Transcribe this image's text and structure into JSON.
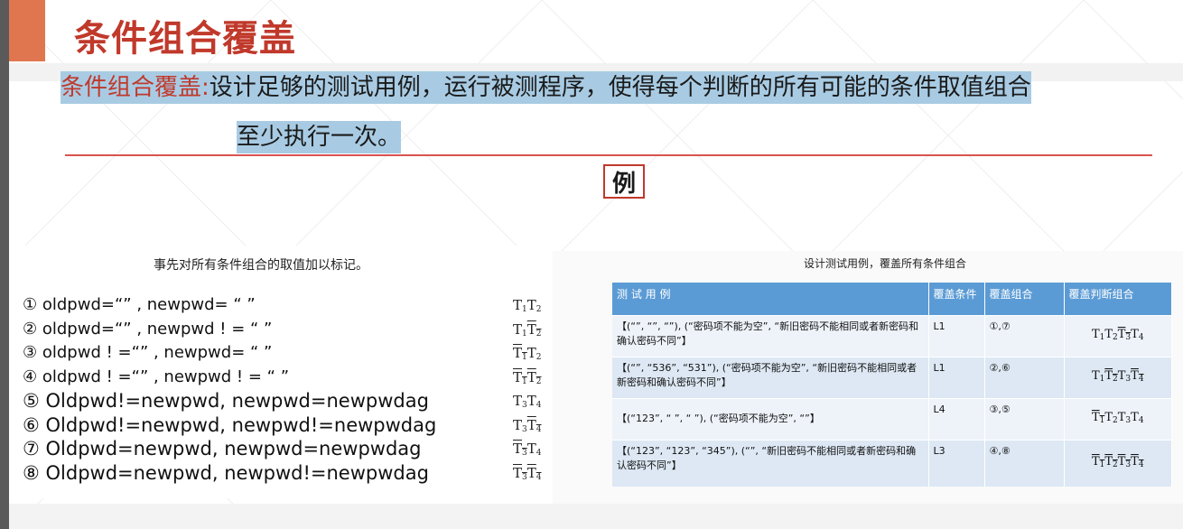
{
  "title": "条件组合覆盖",
  "definition": {
    "term": "条件组合覆盖:",
    "text_line1": "设计足够的测试用例，运行被测程序，使得每个判断的所有可能的条件取值组合",
    "text_line2": "至少执行一次。"
  },
  "example_label": "例",
  "left_panel": {
    "heading": "事先对所有条件组合的取值加以标记。",
    "cases": [
      "① oldpwd=“” , newpwd= “ ”",
      "② oldpwd=“” , newpwd ! = “ ”",
      "③ oldpwd ! =“” , newpwd= “ ”",
      "④ oldpwd ! =“” , newpwd ! = “ ”",
      "⑤ Oldpwd!=newpwd, newpwd=newpwdag",
      "⑥ Oldpwd!=newpwd, newpwd!=newpwdag",
      "⑦ Oldpwd=newpwd, newpwd=newpwdag",
      "⑧ Oldpwd=newpwd, newpwd!=newpwdag"
    ],
    "tlabels": [
      [
        {
          "t": "T",
          "n": "1",
          "neg": false
        },
        {
          "t": "T",
          "n": "2",
          "neg": false
        }
      ],
      [
        {
          "t": "T",
          "n": "1",
          "neg": false
        },
        {
          "t": "T",
          "n": "2",
          "neg": true
        }
      ],
      [
        {
          "t": "T",
          "n": "1",
          "neg": true
        },
        {
          "t": "T",
          "n": "2",
          "neg": false
        }
      ],
      [
        {
          "t": "T",
          "n": "1",
          "neg": true
        },
        {
          "t": "T",
          "n": "2",
          "neg": true
        }
      ],
      [
        {
          "t": "T",
          "n": "3",
          "neg": false
        },
        {
          "t": "T",
          "n": "4",
          "neg": false
        }
      ],
      [
        {
          "t": "T",
          "n": "3",
          "neg": false
        },
        {
          "t": "T",
          "n": "4",
          "neg": true
        }
      ],
      [
        {
          "t": "T",
          "n": "3",
          "neg": true
        },
        {
          "t": "T",
          "n": "4",
          "neg": false
        }
      ],
      [
        {
          "t": "T",
          "n": "3",
          "neg": true
        },
        {
          "t": "T",
          "n": "4",
          "neg": true
        }
      ]
    ]
  },
  "right_panel": {
    "heading": "设计测试用例，覆盖所有条件组合",
    "columns": [
      "测 试 用 例",
      "覆盖条件",
      "覆盖组合",
      "覆盖判断组合"
    ],
    "rows": [
      {
        "case": "【(“”, “”, “”), (“密码项不能为空”, “新旧密码不能相同或者新密码和确认密码不同”】",
        "condition": "L1",
        "combo": "①,⑦",
        "decision": [
          {
            "n": "1",
            "neg": false
          },
          {
            "n": "2",
            "neg": false
          },
          {
            "n": "3",
            "neg": true
          },
          {
            "n": "4",
            "neg": false
          }
        ]
      },
      {
        "case": "【(“”, “536”, “531”), (“密码项不能为空”, “新旧密码不能相同或者新密码和确认密码不同”】",
        "condition": "L1",
        "combo": "②,⑥",
        "decision": [
          {
            "n": "1",
            "neg": false
          },
          {
            "n": "2",
            "neg": true
          },
          {
            "n": "3",
            "neg": false
          },
          {
            "n": "4",
            "neg": true
          }
        ]
      },
      {
        "case": "【(“123”, “ ”, “ ”), (“密码项不能为空”, “”】",
        "condition": "L4",
        "combo": "③,⑤",
        "decision": [
          {
            "n": "1",
            "neg": true
          },
          {
            "n": "2",
            "neg": false
          },
          {
            "n": "3",
            "neg": false
          },
          {
            "n": "4",
            "neg": false
          }
        ]
      },
      {
        "case": "【(“123”, “123”, “345”), (“”, “新旧密码不能相同或者新密码和确认密码不同”】",
        "condition": "L3",
        "combo": "④,⑧",
        "decision": [
          {
            "n": "1",
            "neg": true
          },
          {
            "n": "2",
            "neg": true
          },
          {
            "n": "3",
            "neg": true
          },
          {
            "n": "4",
            "neg": true
          }
        ]
      }
    ]
  },
  "colors": {
    "title": "#c0392b",
    "highlight": "#a8cbe3",
    "accent_bar": "#e07650",
    "table_header": "#5b9bd5"
  }
}
